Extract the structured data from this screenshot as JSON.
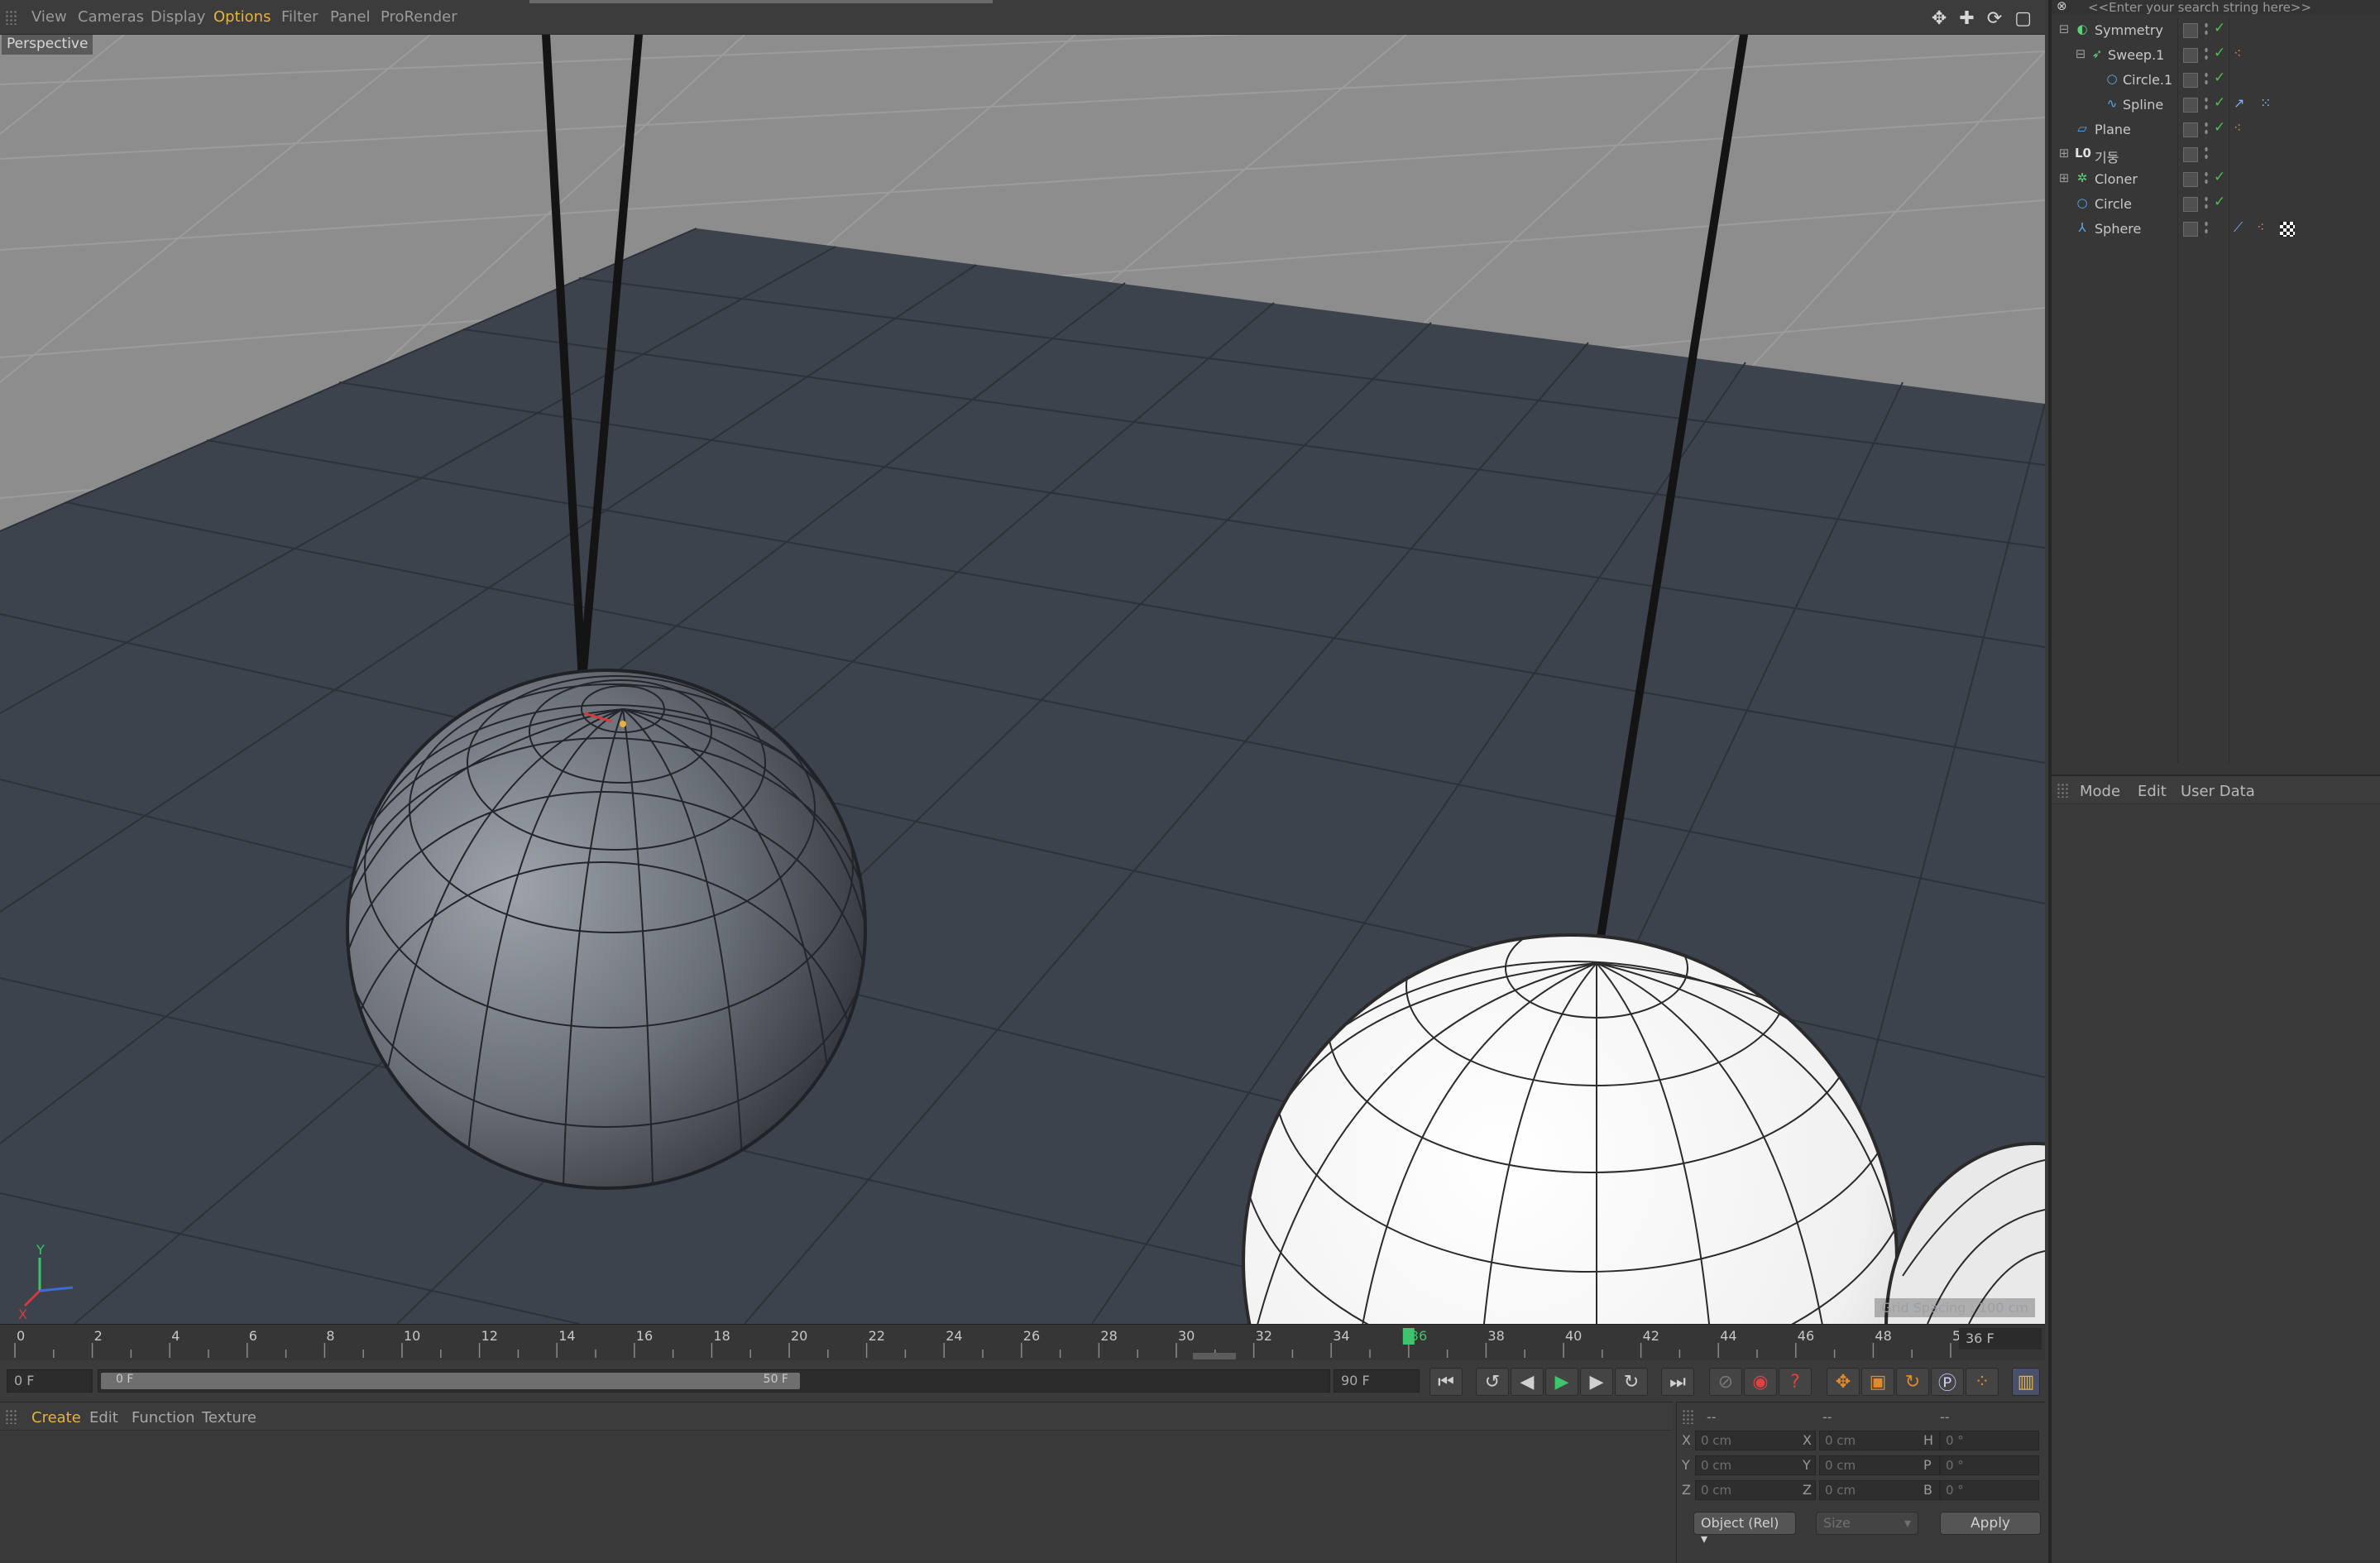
{
  "viewport_menu": {
    "items": [
      {
        "label": "View"
      },
      {
        "label": "Cameras"
      },
      {
        "label": "Display"
      },
      {
        "label": "Options"
      },
      {
        "label": "Filter"
      },
      {
        "label": "Panel"
      },
      {
        "label": "ProRender"
      }
    ],
    "active": "Options",
    "nav_icons": "✥ ✚ ⟳ ▢"
  },
  "viewport": {
    "camera_label": "Perspective",
    "grid_spacing": "Grid Spacing : 100 cm",
    "axis_labels": {
      "y": "Y",
      "x": "X"
    }
  },
  "timeline": {
    "ticks": [
      "0",
      "2",
      "4",
      "6",
      "8",
      "10",
      "12",
      "14",
      "16",
      "18",
      "20",
      "22",
      "24",
      "26",
      "28",
      "30",
      "32",
      "34",
      "36",
      "38",
      "40",
      "42",
      "44",
      "46",
      "48",
      "50"
    ],
    "current_frame": "36",
    "frame_field": "36 F"
  },
  "transport": {
    "start_field": "0 F",
    "range_start": "0 F",
    "range_end": "50 F",
    "end_field": "90 F"
  },
  "material_menu": {
    "items": [
      {
        "label": "Create"
      },
      {
        "label": "Edit"
      },
      {
        "label": "Function"
      },
      {
        "label": "Texture"
      }
    ],
    "active": "Create"
  },
  "coordinates": {
    "headers": [
      "--",
      "--",
      "--"
    ],
    "rows": [
      {
        "a": "X",
        "av": "0 cm",
        "b": "X",
        "bv": "0 cm",
        "c": "H",
        "cv": "0 °"
      },
      {
        "a": "Y",
        "av": "0 cm",
        "b": "Y",
        "bv": "0 cm",
        "c": "P",
        "cv": "0 °"
      },
      {
        "a": "Z",
        "av": "0 cm",
        "b": "Z",
        "bv": "0 cm",
        "c": "B",
        "cv": "0 °"
      }
    ],
    "mode_dropdown": "Object (Rel)",
    "size_dropdown": "Size",
    "apply_label": "Apply"
  },
  "object_manager": {
    "search_placeholder": "<<Enter your search string here>>",
    "objects": [
      {
        "name": "Symmetry",
        "indent": 0,
        "icon": "symmetry-icon"
      },
      {
        "name": "Sweep.1",
        "indent": 1,
        "icon": "sweep-icon"
      },
      {
        "name": "Circle.1",
        "indent": 2,
        "icon": "circle-spline-icon"
      },
      {
        "name": "Spline",
        "indent": 2,
        "icon": "spline-icon"
      },
      {
        "name": "Plane",
        "indent": 0,
        "icon": "plane-icon"
      },
      {
        "name": "기둥",
        "indent": 0,
        "icon": "null-group-icon"
      },
      {
        "name": "Cloner",
        "indent": 0,
        "icon": "cloner-icon"
      },
      {
        "name": "Circle",
        "indent": 0,
        "icon": "circle-spline-icon"
      },
      {
        "name": "Sphere",
        "indent": 0,
        "icon": "sphere-icon"
      }
    ]
  },
  "attributes_menu": {
    "items": [
      {
        "label": "Mode"
      },
      {
        "label": "Edit"
      },
      {
        "label": "User Data"
      }
    ]
  },
  "colors": {
    "accent": "#e6b33c",
    "timeline_marker": "#3ec46d",
    "check": "#4fbf4f",
    "tag_orange": "#e08a2c"
  }
}
